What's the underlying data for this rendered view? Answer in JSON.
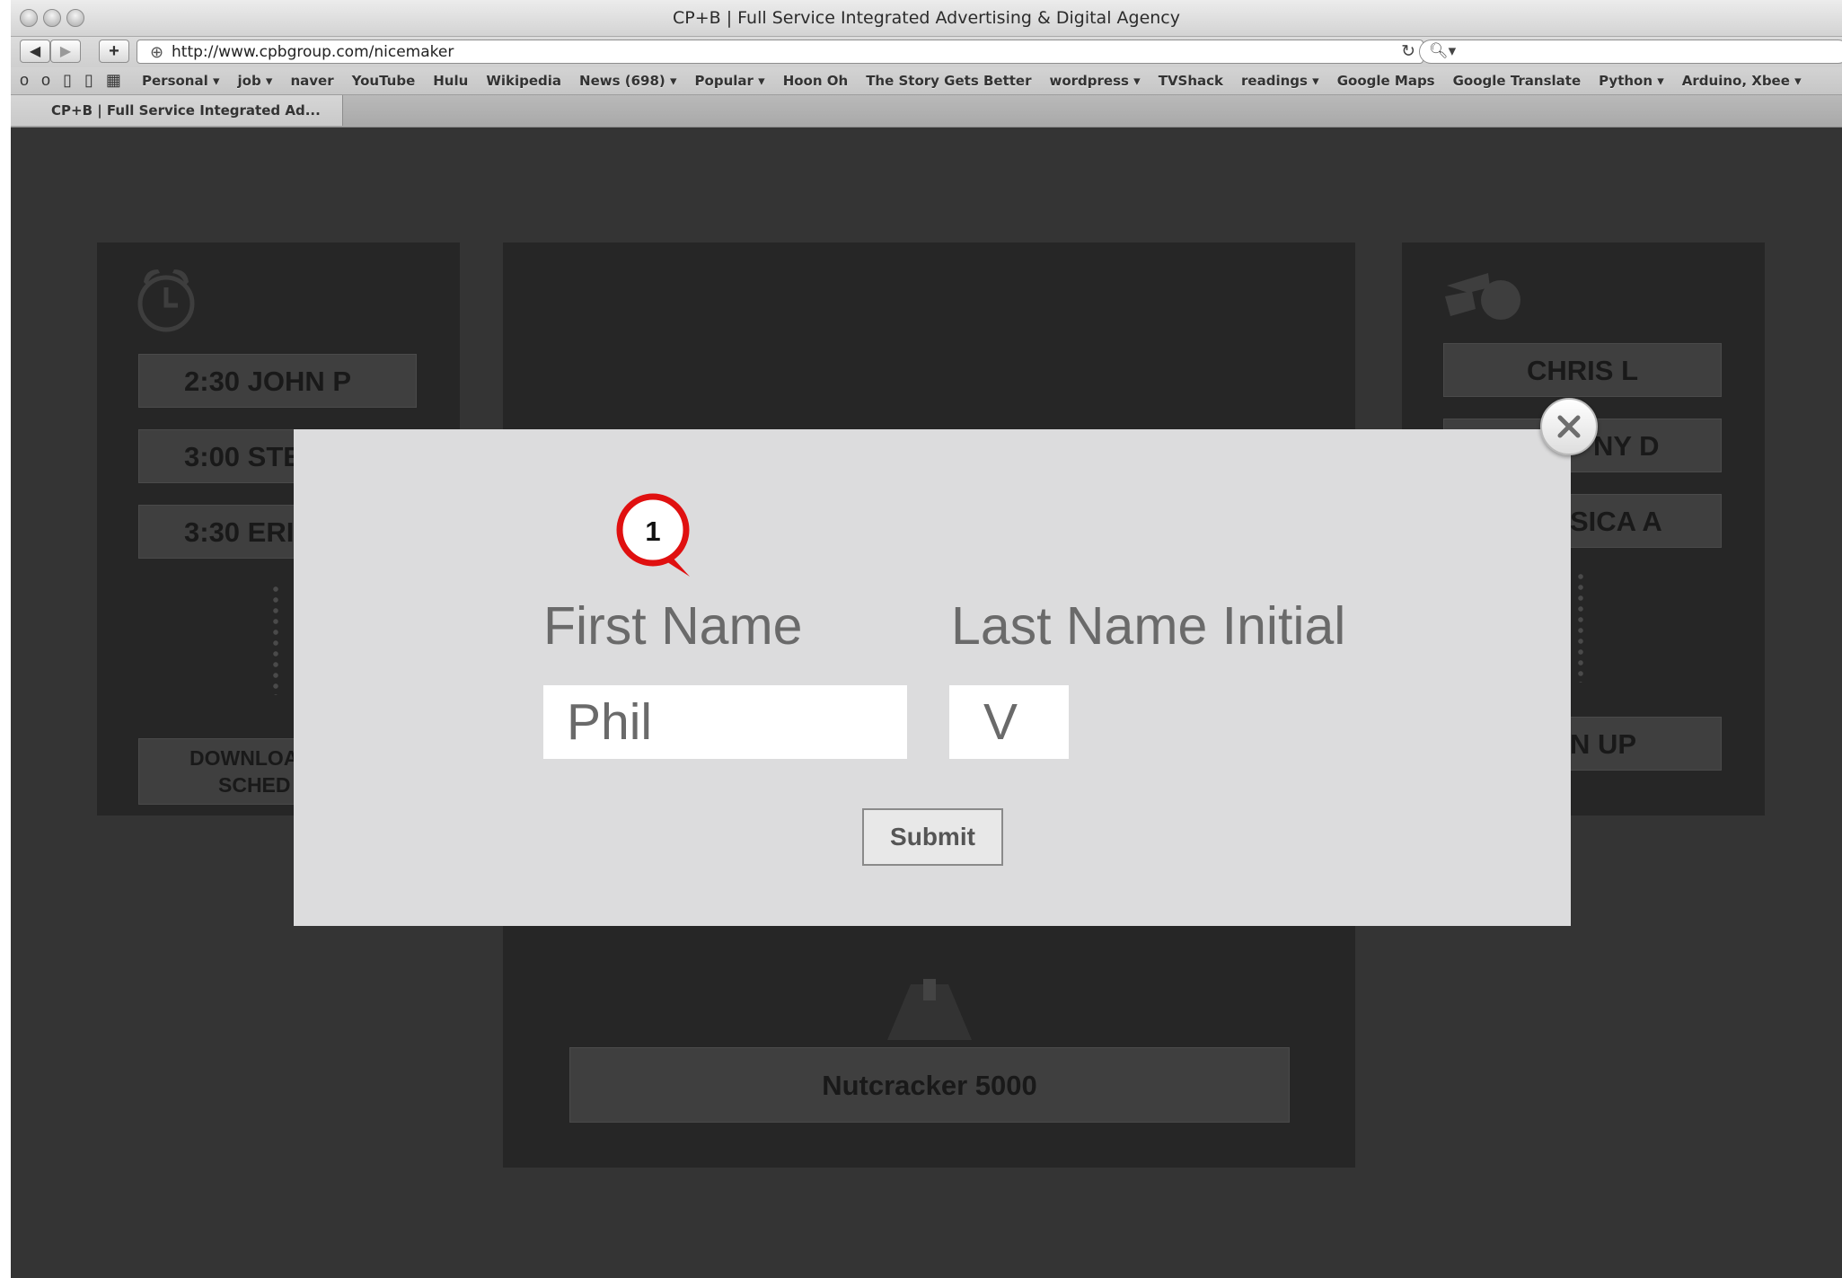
{
  "browser": {
    "window_title": "CP+B | Full Service Integrated Advertising & Digital Agency",
    "url": "http://www.cpbgroup.com/nicemaker",
    "tab_title": "CP+B | Full Service Integrated Ad...",
    "bookmarks": [
      "Personal ▾",
      "job ▾",
      "naver",
      "YouTube",
      "Hulu",
      "Wikipedia",
      "News (698) ▾",
      "Popular ▾",
      "Hoon Oh",
      "The Story Gets Better",
      "wordpress ▾",
      "TVShack",
      "readings ▾",
      "Google Maps",
      "Google Translate",
      "Python ▾",
      "Arduino, Xbee ▾"
    ]
  },
  "left_panel": {
    "icon": "alarm-clock-icon",
    "items": [
      "2:30 JOHN P",
      "3:00 STE",
      "3:30 ERI"
    ],
    "download_line1": "DOWNLOA",
    "download_line2": "SCHED"
  },
  "right_panel": {
    "icon": "whistle-icon",
    "items": [
      "CHRIS L",
      "NY D",
      "SICA A"
    ],
    "signup": "N UP"
  },
  "center_panel": {
    "product_label": "Nutcracker 5000"
  },
  "modal": {
    "annotation_number": "1",
    "first_name_label": "First Name",
    "last_name_label": "Last Name Initial",
    "first_name_value": "Phil",
    "last_initial_value": "V",
    "submit_label": "Submit",
    "close_icon": "close-icon"
  },
  "colors": {
    "page_bg": "#343434",
    "panel_bg": "#262626",
    "modal_bg": "#dcdcdd",
    "annotation_red": "#e01010"
  }
}
